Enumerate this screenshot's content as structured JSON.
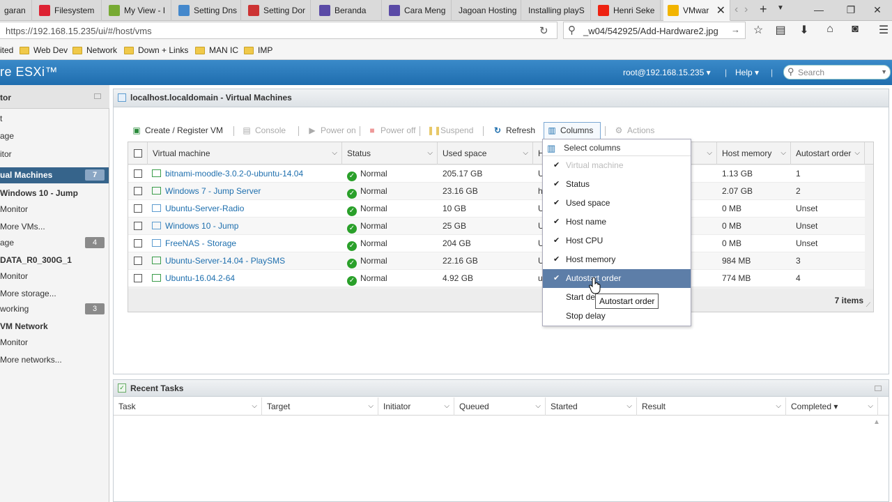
{
  "browser": {
    "tabs": [
      {
        "label": "garan",
        "fav_color": "#c33"
      },
      {
        "label": "Filesystem",
        "fav_color": "#d23"
      },
      {
        "label": "My View - I",
        "fav_color": "#7a3"
      },
      {
        "label": "Setting Dns",
        "fav_color": "#48c"
      },
      {
        "label": "Setting Dor",
        "fav_color": "#c33"
      },
      {
        "label": "Beranda",
        "fav_color": "#5a4aa6"
      },
      {
        "label": "Cara Meng",
        "fav_color": "#5a4aa6"
      },
      {
        "label": "Jagoan Hosting",
        "fav_color": "#ddd"
      },
      {
        "label": "Installing playS",
        "fav_color": "#ddd"
      },
      {
        "label": "Henri Seke",
        "fav_color": "#e21"
      },
      {
        "label": "VMwar",
        "fav_color": "#f2b400"
      }
    ],
    "url": "https://192.168.15.235/ui/#/host/vms",
    "search_text": "_w04/542925/Add-Hardware2.jpg",
    "bookmarks": [
      "ited",
      "Web Dev",
      "Network",
      "Down + Links",
      "MAN IC",
      "IMP"
    ]
  },
  "esxi": {
    "brand": "re ESXi™",
    "user": "root@192.168.15.235",
    "help": "Help",
    "search_placeholder": "Search"
  },
  "navigator": {
    "title": "tor",
    "items": [
      {
        "label": "t"
      },
      {
        "label": "age"
      },
      {
        "label": "itor"
      },
      {
        "label": "ual Machines",
        "badge": "7"
      },
      {
        "label": "Windows 10 - Jump"
      },
      {
        "label": "Monitor"
      },
      {
        "label": "More VMs..."
      },
      {
        "label": "age",
        "badge": "4"
      },
      {
        "label": "DATA_R0_300G_1"
      },
      {
        "label": "Monitor"
      },
      {
        "label": "More storage..."
      },
      {
        "label": "working",
        "badge": "3"
      },
      {
        "label": "VM Network"
      },
      {
        "label": "Monitor"
      },
      {
        "label": "More networks..."
      }
    ]
  },
  "main": {
    "title": "localhost.localdomain - Virtual Machines",
    "toolbar": {
      "create": "Create / Register VM",
      "console": "Console",
      "power_on": "Power on",
      "power_off": "Power off",
      "suspend": "Suspend",
      "refresh": "Refresh",
      "columns": "Columns",
      "actions": "Actions"
    },
    "columns": [
      "Virtual machine",
      "Status",
      "Used space",
      "H",
      "Host memory",
      "Autostart order"
    ],
    "rows": [
      {
        "name": "bitnami-moodle-3.0.2-0-ubuntu-14.04",
        "status": "Normal",
        "used": "205.17 GB",
        "h": "U",
        "mem": "1.13 GB",
        "auto": "1",
        "on": true
      },
      {
        "name": "Windows 7 - Jump Server",
        "status": "Normal",
        "used": "23.16 GB",
        "h": "h",
        "mem": "2.07 GB",
        "auto": "2",
        "on": true
      },
      {
        "name": "Ubuntu-Server-Radio",
        "status": "Normal",
        "used": "10 GB",
        "h": "U",
        "mem": "0 MB",
        "auto": "Unset",
        "on": false
      },
      {
        "name": "Windows 10 - Jump",
        "status": "Normal",
        "used": "25 GB",
        "h": "U",
        "mem": "0 MB",
        "auto": "Unset",
        "on": false
      },
      {
        "name": "FreeNAS - Storage",
        "status": "Normal",
        "used": "204 GB",
        "h": "U",
        "mem": "0 MB",
        "auto": "Unset",
        "on": false
      },
      {
        "name": "Ubuntu-Server-14.04 - PlaySMS",
        "status": "Normal",
        "used": "22.16 GB",
        "h": "U",
        "mem": "984 MB",
        "auto": "3",
        "on": true
      },
      {
        "name": "Ubuntu-16.04.2-64",
        "status": "Normal",
        "used": "4.92 GB",
        "h": "u",
        "mem": "774 MB",
        "auto": "4",
        "on": true
      }
    ],
    "item_count": "7 items"
  },
  "columns_menu": {
    "header": "Select columns",
    "items": [
      {
        "label": "Virtual machine",
        "checked": true,
        "disabled": true
      },
      {
        "label": "Status",
        "checked": true
      },
      {
        "label": "Used space",
        "checked": true
      },
      {
        "label": "Host name",
        "checked": true
      },
      {
        "label": "Host CPU",
        "checked": true
      },
      {
        "label": "Host memory",
        "checked": true
      },
      {
        "label": "Autostart order",
        "checked": true,
        "highlighted": true
      },
      {
        "label": "Start de",
        "checked": false
      },
      {
        "label": "Stop delay",
        "checked": false
      }
    ],
    "tooltip": "Autostart order"
  },
  "tasks": {
    "title": "Recent Tasks",
    "columns": [
      "Task",
      "Target",
      "Initiator",
      "Queued",
      "Started",
      "Result",
      "Completed ▾"
    ]
  }
}
